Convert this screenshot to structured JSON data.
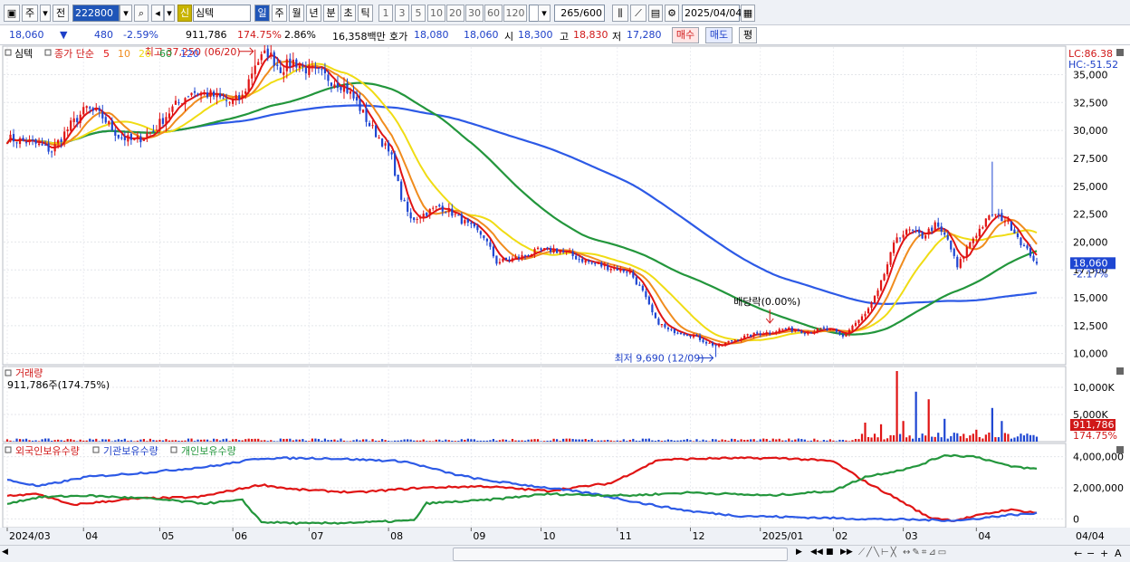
{
  "toolbar": {
    "period_btn": "주",
    "prev_btn": "전",
    "code": "222800",
    "name": "심텍",
    "credit_badge": "신",
    "tf_day": "일",
    "tf_week": "주",
    "tf_month": "월",
    "tf_year": "년",
    "tf_minute": "분",
    "tf_second": "초",
    "tf_tick": "틱",
    "intervals": [
      "1",
      "3",
      "5",
      "10",
      "20",
      "30",
      "60",
      "120"
    ],
    "count": "265",
    "count_total": "/600",
    "date": "2025/04/04"
  },
  "quote": {
    "price": "18,060",
    "change": "480",
    "change_pct": "-2.59%",
    "volume": "911,786",
    "volume_ratio": "174.75%",
    "turnover_pct": "2.86%",
    "amount": "16,358백만",
    "bid_ask_label": "호가",
    "ask": "18,080",
    "bid": "18,060",
    "open_label": "시",
    "open": "18,300",
    "high_label": "고",
    "high": "18,830",
    "low_label": "저",
    "low": "17,280",
    "buy_btn": "매수",
    "sell_btn": "매도",
    "eval_btn": "평"
  },
  "price_panel": {
    "title": "심텍",
    "ma_label": "종가 단순",
    "ma_periods": [
      "5",
      "10",
      "20",
      "60",
      "120"
    ],
    "ma_colors": [
      "#e01414",
      "#f08c1e",
      "#f0dc14",
      "#23963c",
      "#2d5ae6"
    ],
    "lc": "LC:86.38",
    "hc": "HC:-51.52",
    "high_note": "최고 37,250 (06/20)",
    "low_note": "최저 9,690 (12/09)",
    "dividend_note": "배당락(0.00%)",
    "last_price": "18,060",
    "last_change": "-2.17%",
    "y_ticks": [
      "35,000",
      "32,500",
      "30,000",
      "27,500",
      "25,000",
      "22,500",
      "20,000",
      "17,500",
      "15,000",
      "12,500",
      "10,000"
    ]
  },
  "volume_panel": {
    "title": "거래량",
    "info": "911,786주(174.75%)",
    "y_ticks": [
      "10,000K",
      "5,000K"
    ],
    "last_volume": "911,786",
    "last_ratio": "174.75%"
  },
  "holding_panel": {
    "labels": [
      "외국인보유수량",
      "기관보유수량",
      "개인보유수량"
    ],
    "y_ticks": [
      "4,000,000",
      "2,000,000",
      "0"
    ]
  },
  "x_axis": {
    "labels": [
      "2024/03",
      "04",
      "05",
      "06",
      "07",
      "08",
      "09",
      "10",
      "11",
      "12",
      "2025/01",
      "02",
      "03",
      "04"
    ],
    "cursor_label": "04/04"
  },
  "chart_data": {
    "type": "candlestick",
    "x_range": [
      "2024/03",
      "2025/04/04"
    ],
    "price_ylim": [
      9000,
      36500
    ],
    "anchors_close": [
      [
        0,
        29300
      ],
      [
        8,
        28900
      ],
      [
        14,
        28200
      ],
      [
        20,
        30500
      ],
      [
        25,
        32000
      ],
      [
        30,
        31200
      ],
      [
        35,
        29500
      ],
      [
        40,
        29000
      ],
      [
        46,
        30000
      ],
      [
        52,
        32000
      ],
      [
        58,
        33500
      ],
      [
        64,
        33200
      ],
      [
        70,
        32500
      ],
      [
        74,
        33000
      ],
      [
        78,
        36000
      ],
      [
        82,
        37000
      ],
      [
        86,
        35500
      ],
      [
        90,
        36200
      ],
      [
        94,
        35500
      ],
      [
        98,
        35200
      ],
      [
        102,
        34500
      ],
      [
        106,
        34000
      ],
      [
        110,
        32500
      ],
      [
        114,
        30500
      ],
      [
        118,
        29000
      ],
      [
        121,
        27500
      ],
      [
        124,
        24000
      ],
      [
        127,
        22000
      ],
      [
        131,
        22500
      ],
      [
        136,
        23200
      ],
      [
        140,
        22600
      ],
      [
        145,
        21500
      ],
      [
        150,
        20500
      ],
      [
        154,
        18200
      ],
      [
        158,
        18400
      ],
      [
        162,
        18700
      ],
      [
        167,
        19200
      ],
      [
        172,
        19300
      ],
      [
        176,
        19000
      ],
      [
        180,
        18500
      ],
      [
        184,
        18100
      ],
      [
        188,
        17800
      ],
      [
        192,
        17600
      ],
      [
        196,
        17300
      ],
      [
        200,
        15500
      ],
      [
        204,
        13000
      ],
      [
        208,
        12100
      ],
      [
        212,
        11900
      ],
      [
        216,
        11600
      ],
      [
        220,
        11000
      ],
      [
        224,
        10600
      ],
      [
        228,
        11200
      ],
      [
        232,
        11500
      ],
      [
        236,
        11800
      ],
      [
        240,
        11900
      ],
      [
        244,
        12200
      ],
      [
        248,
        12100
      ],
      [
        252,
        11900
      ],
      [
        256,
        12200
      ],
      [
        260,
        12000
      ],
      [
        263,
        11500
      ],
      [
        266,
        12500
      ],
      [
        270,
        13500
      ],
      [
        274,
        15500
      ],
      [
        277,
        18000
      ],
      [
        280,
        20500
      ],
      [
        284,
        21000
      ],
      [
        288,
        20500
      ],
      [
        292,
        21500
      ],
      [
        296,
        20200
      ],
      [
        299,
        17700
      ],
      [
        303,
        20000
      ],
      [
        307,
        21500
      ],
      [
        310,
        22500
      ],
      [
        314,
        22000
      ],
      [
        317,
        21000
      ],
      [
        320,
        19500
      ],
      [
        322,
        18900
      ],
      [
        324,
        18060
      ]
    ],
    "high_marker": {
      "value": 37250,
      "date": "06/20"
    },
    "low_marker": {
      "value": 9690,
      "date": "12/09"
    },
    "volume_ylim_k": [
      0,
      13000
    ],
    "volume_spikes_k": [
      [
        270,
        3500
      ],
      [
        275,
        3200
      ],
      [
        280,
        13000
      ],
      [
        282,
        3800
      ],
      [
        286,
        9200
      ],
      [
        290,
        7800
      ],
      [
        295,
        4200
      ],
      [
        305,
        2200
      ],
      [
        310,
        6200
      ],
      [
        313,
        3800
      ]
    ],
    "holding_ylim": [
      -500000,
      4500000
    ],
    "foreign_anchors": [
      [
        0,
        1500000
      ],
      [
        10,
        1600000
      ],
      [
        20,
        900000
      ],
      [
        40,
        1300000
      ],
      [
        60,
        1400000
      ],
      [
        80,
        2200000
      ],
      [
        90,
        1900000
      ],
      [
        110,
        1700000
      ],
      [
        130,
        2000000
      ],
      [
        150,
        2100000
      ],
      [
        170,
        1800000
      ],
      [
        190,
        2300000
      ],
      [
        205,
        3800000
      ],
      [
        225,
        3900000
      ],
      [
        245,
        3900000
      ],
      [
        260,
        3700000
      ],
      [
        270,
        2400000
      ],
      [
        280,
        1300000
      ],
      [
        290,
        100000
      ],
      [
        298,
        -100000
      ],
      [
        305,
        200000
      ],
      [
        315,
        600000
      ],
      [
        324,
        400000
      ]
    ],
    "institution_anchors": [
      [
        0,
        2500000
      ],
      [
        10,
        2100000
      ],
      [
        25,
        2700000
      ],
      [
        45,
        3000000
      ],
      [
        65,
        3400000
      ],
      [
        80,
        3900000
      ],
      [
        100,
        3900000
      ],
      [
        125,
        3700000
      ],
      [
        140,
        2900000
      ],
      [
        150,
        2500000
      ],
      [
        170,
        2000000
      ],
      [
        185,
        1600000
      ],
      [
        200,
        1000000
      ],
      [
        215,
        500000
      ],
      [
        230,
        200000
      ],
      [
        250,
        100000
      ],
      [
        270,
        0
      ],
      [
        285,
        -50000
      ],
      [
        300,
        -100000
      ],
      [
        315,
        250000
      ],
      [
        324,
        350000
      ]
    ],
    "individual_anchors": [
      [
        0,
        1000000
      ],
      [
        10,
        1400000
      ],
      [
        25,
        1500000
      ],
      [
        45,
        1300000
      ],
      [
        62,
        1000000
      ],
      [
        74,
        1200000
      ],
      [
        80,
        -200000
      ],
      [
        95,
        -300000
      ],
      [
        115,
        -200000
      ],
      [
        128,
        -100000
      ],
      [
        132,
        1000000
      ],
      [
        150,
        1200000
      ],
      [
        170,
        1600000
      ],
      [
        195,
        1500000
      ],
      [
        215,
        1700000
      ],
      [
        240,
        1500000
      ],
      [
        260,
        1800000
      ],
      [
        270,
        2700000
      ],
      [
        285,
        3300000
      ],
      [
        295,
        4100000
      ],
      [
        305,
        4000000
      ],
      [
        315,
        3400000
      ],
      [
        324,
        3200000
      ]
    ]
  }
}
